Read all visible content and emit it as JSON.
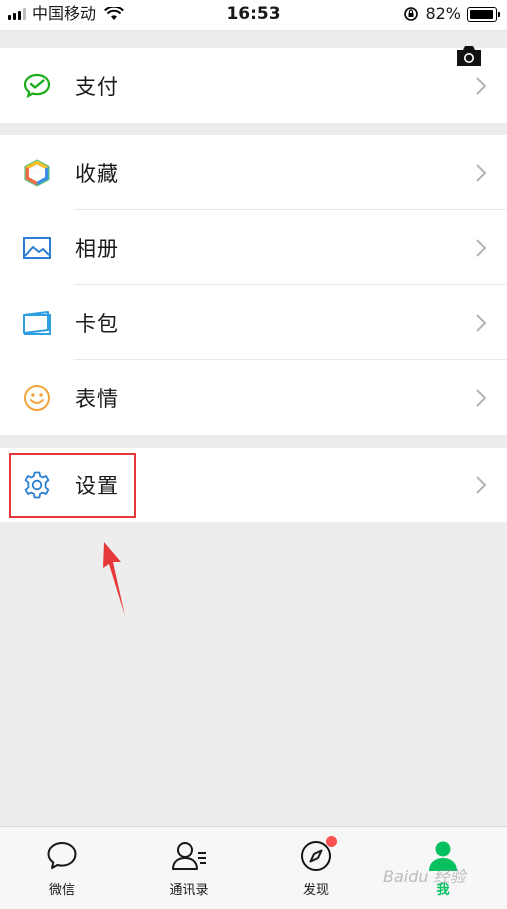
{
  "status_bar": {
    "carrier": "中国移动",
    "time": "16:53",
    "battery": "82%",
    "battery_level": 0.82
  },
  "menu": {
    "group1": [
      {
        "label": "支付",
        "icon": "wechat-pay-icon"
      }
    ],
    "group2": [
      {
        "label": "收藏",
        "icon": "favorites-cube-icon"
      },
      {
        "label": "相册",
        "icon": "album-icon"
      },
      {
        "label": "卡包",
        "icon": "card-wallet-icon"
      },
      {
        "label": "表情",
        "icon": "sticker-smile-icon"
      }
    ],
    "group3": [
      {
        "label": "设置",
        "icon": "settings-gear-icon"
      }
    ]
  },
  "tabs": [
    {
      "label": "微信",
      "icon": "chat-bubble-icon",
      "active": false
    },
    {
      "label": "通讯录",
      "icon": "contacts-icon",
      "active": false
    },
    {
      "label": "发现",
      "icon": "compass-icon",
      "active": false,
      "badge": true
    },
    {
      "label": "我",
      "icon": "me-person-icon",
      "active": true
    }
  ],
  "watermark": "Baidu 经验",
  "colors": {
    "accent_green": "#07c160",
    "highlight_red": "#e5383b",
    "badge_red": "#fa5151",
    "background": "#ededed"
  }
}
